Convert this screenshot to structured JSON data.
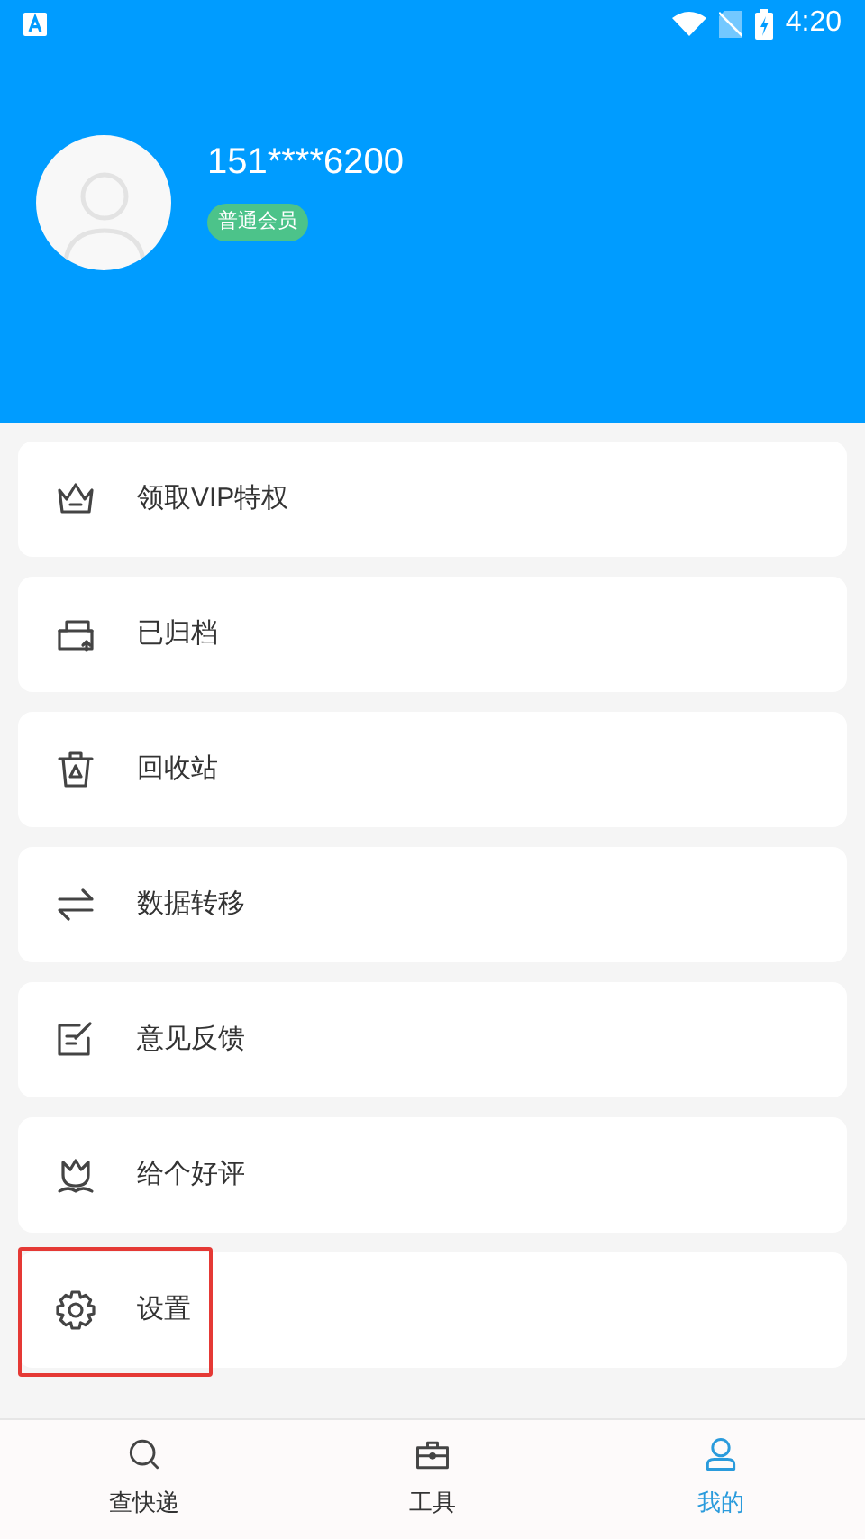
{
  "status_bar": {
    "time": "4:20"
  },
  "profile": {
    "phone": "151****6200",
    "badge": "普通会员"
  },
  "menu": [
    {
      "kind": "crown",
      "label": "领取VIP特权",
      "highlighted": false
    },
    {
      "kind": "archive",
      "label": "已归档",
      "highlighted": false
    },
    {
      "kind": "trash",
      "label": "回收站",
      "highlighted": false
    },
    {
      "kind": "transfer",
      "label": "数据转移",
      "highlighted": false
    },
    {
      "kind": "feedback",
      "label": "意见反馈",
      "highlighted": false
    },
    {
      "kind": "flower",
      "label": "给个好评",
      "highlighted": false
    },
    {
      "kind": "gear",
      "label": "设置",
      "highlighted": true
    }
  ],
  "tabs": [
    {
      "kind": "search",
      "label": "查快递",
      "selected": false
    },
    {
      "kind": "toolbox",
      "label": "工具",
      "selected": false
    },
    {
      "kind": "person",
      "label": "我的",
      "selected": true
    }
  ]
}
